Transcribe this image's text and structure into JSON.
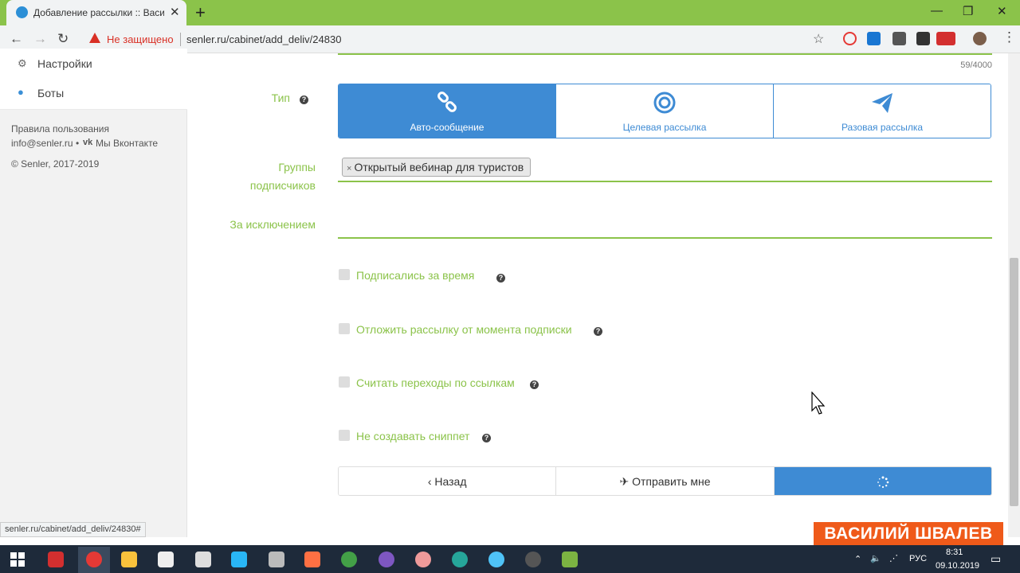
{
  "browser": {
    "tab_title": "Добавление рассылки :: Васина",
    "tab_close": "✕",
    "new_tab": "+",
    "window_controls": [
      "—",
      "❐",
      "✕"
    ],
    "security_warning": "Не защищено",
    "url": "senler.ru/cabinet/add_deliv/24830",
    "status_url": "senler.ru/cabinet/add_deliv/24830#"
  },
  "sidebar": {
    "items": [
      {
        "label": "Настройки",
        "icon": "gear-icon"
      },
      {
        "label": "Боты",
        "icon": "android-icon"
      }
    ],
    "footer": {
      "terms": "Правила пользования",
      "email": "info@senler.ru",
      "separator": "•",
      "vk_logo": "vk",
      "vk_link": "Мы Вконтакте",
      "copyright": "© Senler, 2017-2019"
    }
  },
  "form": {
    "char_counter": "59/4000",
    "type_label": "Тип",
    "type_options": [
      {
        "label": "Авто-сообщение",
        "icon": "link-icon",
        "active": true
      },
      {
        "label": "Целевая рассылка",
        "icon": "target-icon",
        "active": false
      },
      {
        "label": "Разовая рассылка",
        "icon": "paper-plane-icon",
        "active": false
      }
    ],
    "groups_label_1": "Группы",
    "groups_label_2": "подписчиков",
    "groups_tag_remove": "×",
    "groups_tag": "Открытый вебинар для туристов",
    "except_label": "За исключением",
    "checkboxes": [
      {
        "label": "Подписались за время",
        "checked": false
      },
      {
        "label": "Отложить рассылку от момента подписки",
        "checked": false
      },
      {
        "label": "Считать переходы по ссылкам",
        "checked": false
      },
      {
        "label": "Не создавать сниппет",
        "checked": false
      }
    ],
    "back_button": "‹ Назад",
    "send_me_button": "Отправить мне",
    "help_glyph": "?"
  },
  "watermark": "ВАСИЛИЙ ШВАЛЕВ",
  "taskbar": {
    "language": "РУС",
    "time": "8:31",
    "date": "09.10.2019"
  },
  "colors": {
    "accent_green": "#8bc34a",
    "accent_blue": "#3e8bd4",
    "warning_red": "#d93025",
    "watermark_orange": "#ef5a1a"
  }
}
